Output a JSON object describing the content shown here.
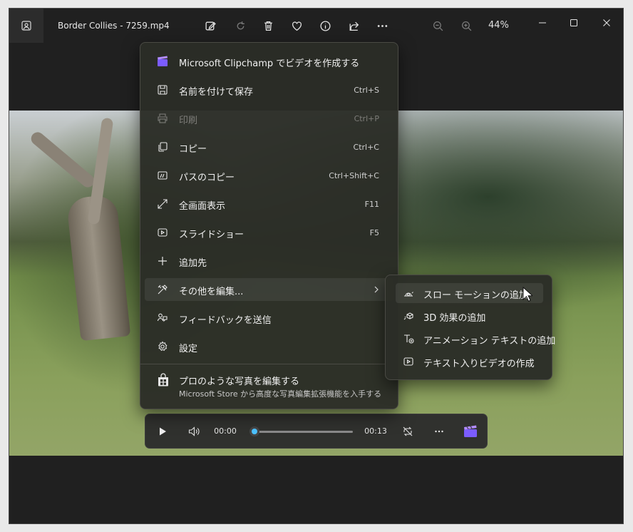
{
  "window": {
    "title": "Border Collies - 7259.mp4",
    "zoom_level": "44%"
  },
  "toolbar": {
    "icons": [
      "edit-image-icon",
      "rotate-icon",
      "delete-icon",
      "favorite-heart-icon",
      "info-icon",
      "share-icon",
      "more-icon",
      "zoom-out-icon",
      "zoom-in-icon"
    ]
  },
  "context_menu": {
    "items": [
      {
        "label": "Microsoft Clipchamp でビデオを作成する",
        "shortcut": ""
      },
      {
        "label": "名前を付けて保存",
        "shortcut": "Ctrl+S"
      },
      {
        "label": "印刷",
        "shortcut": "Ctrl+P"
      },
      {
        "label": "コピー",
        "shortcut": "Ctrl+C"
      },
      {
        "label": "パスのコピー",
        "shortcut": "Ctrl+Shift+C"
      },
      {
        "label": "全画面表示",
        "shortcut": "F11"
      },
      {
        "label": "スライドショー",
        "shortcut": "F5"
      },
      {
        "label": "追加先",
        "shortcut": ""
      },
      {
        "label": "その他を編集...",
        "shortcut": ""
      },
      {
        "label": "フィードバックを送信",
        "shortcut": ""
      },
      {
        "label": "設定",
        "shortcut": ""
      }
    ],
    "promo": {
      "title": "プロのような写真を編集する",
      "subtitle": "Microsoft Store から高度な写真編集拡張機能を入手する"
    }
  },
  "submenu": {
    "items": [
      {
        "label": "スロー モーションの追加"
      },
      {
        "label": "3D 効果の追加"
      },
      {
        "label": "アニメーション テキストの追加"
      },
      {
        "label": "テキスト入りビデオの作成"
      }
    ]
  },
  "player": {
    "current_time": "00:00",
    "duration": "00:13",
    "progress": 0.0
  },
  "colors": {
    "accent": "#4cc2ff",
    "clipchamp": "#7b5cff"
  }
}
